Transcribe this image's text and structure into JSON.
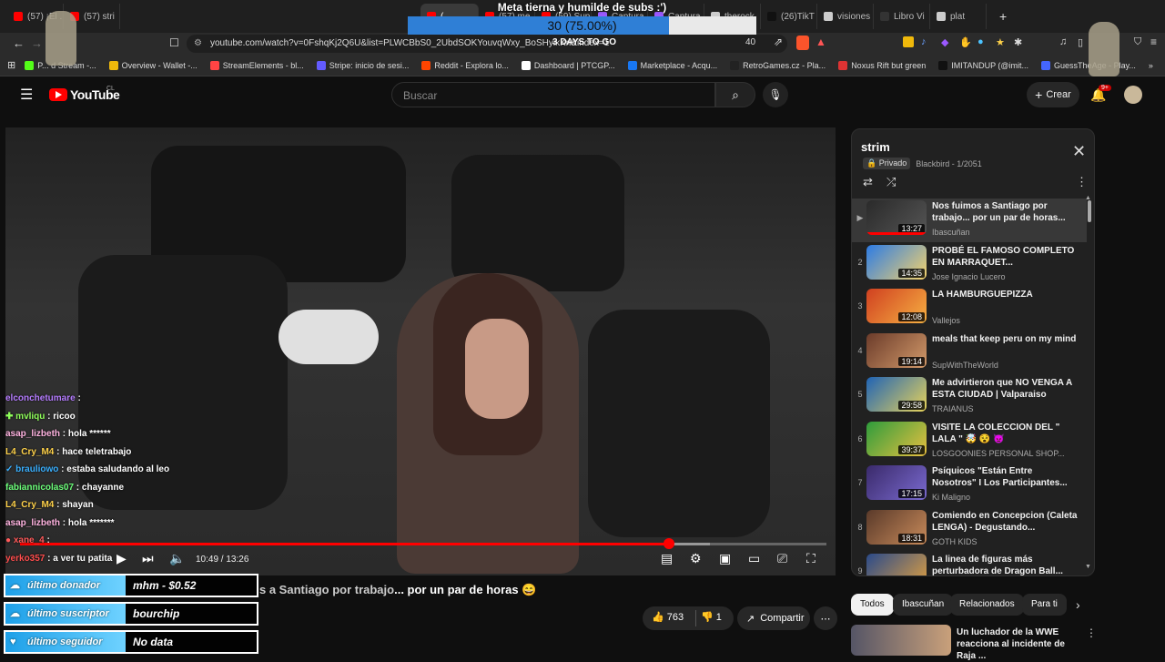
{
  "browser": {
    "tabs": [
      {
        "label": "(57) ¡El ...",
        "color": "#ff0000"
      },
      {
        "label": "(57) stri",
        "color": "#ff0000"
      },
      {
        "label": "(",
        "color": "#ff0000",
        "active": true
      },
      {
        "label": "(57) me",
        "color": "#ff0000"
      },
      {
        "label": "(59) Sup",
        "color": "#ff0000"
      },
      {
        "label": "Captura",
        "color": "#9b59ff"
      },
      {
        "label": "Captura",
        "color": "#9b59ff"
      },
      {
        "label": "therock",
        "color": "#cccccc"
      },
      {
        "label": "(26)TikT",
        "color": "#111111"
      },
      {
        "label": "visiones",
        "color": "#cccccc"
      },
      {
        "label": "Libro Vi",
        "color": "#333333"
      },
      {
        "label": "plat",
        "color": "#cccccc"
      }
    ],
    "url": "youtube.com/watch?v=0FshqKj2Q6U&list=PLWCBbS0_2UbdSOKYouvqWxy_BoSHyikKn&index=1",
    "zoom": "40",
    "bookmarks": [
      {
        "label": "P... d Stream -...",
        "color": "#53fc18"
      },
      {
        "label": "Overview - Wallet -...",
        "color": "#f0b90b"
      },
      {
        "label": "StreamElements - bl...",
        "color": "#ff4444"
      },
      {
        "label": "Stripe: inicio de sesi...",
        "color": "#635bff"
      },
      {
        "label": "Reddit - Explora lo...",
        "color": "#ff4500"
      },
      {
        "label": "Dashboard | PTCGP...",
        "color": "#ffffff"
      },
      {
        "label": "Marketplace - Acqu...",
        "color": "#1877f2"
      },
      {
        "label": "RetroGames.cz - Pla...",
        "color": "#222222"
      },
      {
        "label": "Noxus Rift but green",
        "color": "#dd3333"
      },
      {
        "label": "IMITANDUP (@imit...",
        "color": "#111111"
      },
      {
        "label": "GuessTheAge - Play...",
        "color": "#4466ff"
      }
    ]
  },
  "goal": {
    "title": "Meta tierna y humilde de subs :')",
    "progress_text": "30 (75.00%)",
    "progress": 0.75,
    "days": "3 DAYS TO GO"
  },
  "yt": {
    "logo": "YouTube",
    "country": "CL",
    "search_placeholder": "Buscar",
    "create": "Crear",
    "notif_count": "9+"
  },
  "player": {
    "time": "10:49 / 13:26",
    "progress": 0.805,
    "loaded": 0.855
  },
  "chat": [
    {
      "user": "elconchetumare",
      "text": " : ",
      "color": "#b57cff"
    },
    {
      "user": "mvliqu",
      "text": " : ricoo",
      "color": "#8fff5a",
      "prefix": "✚ "
    },
    {
      "user": "asap_lizbeth",
      "text": " : hola ******",
      "color": "#ffb3e0"
    },
    {
      "user": "L4_Cry_M4",
      "text": " : hace teletrabajo",
      "color": "#ffd24a"
    },
    {
      "user": "brauliowo",
      "text": " : estaba saludando al leo",
      "color": "#3ab0ff",
      "prefix": "✓ "
    },
    {
      "user": "fabiannicolas07",
      "text": " : chayanne",
      "color": "#6cff7a"
    },
    {
      "user": "L4_Cry_M4",
      "text": " : shayan",
      "color": "#ffd24a"
    },
    {
      "user": "asap_lizbeth",
      "text": " : hola *******",
      "color": "#ffb3e0"
    },
    {
      "user": "xane_4",
      "text": " : ",
      "color": "#ff5a5a",
      "prefix": "● "
    },
    {
      "user": "yerko357",
      "text": " : a ver tu patita",
      "color": "#ff4d4d"
    }
  ],
  "playlist": {
    "title": "strim",
    "privacy": "Privado",
    "meta": "Blackbird - 1/2051",
    "items": [
      {
        "index": "▶",
        "title": "Nos fuimos a Santiago por trabajo... por un par de horas...",
        "channel": "Ibascuñan",
        "duration": "13:27",
        "c1": "#2a2a2a",
        "c2": "#555555"
      },
      {
        "index": "2",
        "title": "PROBÉ EL FAMOSO COMPLETO EN MARRAQUET...",
        "channel": "Jose Ignacio Lucero",
        "duration": "14:35",
        "c1": "#2c7be5",
        "c2": "#f5d36b"
      },
      {
        "index": "3",
        "title": "LA HAMBURGUEPIZZA",
        "channel": "Vallejos",
        "duration": "12:08",
        "c1": "#d04020",
        "c2": "#f6b042"
      },
      {
        "index": "4",
        "title": "meals that keep peru on my mind",
        "channel": "SupWithTheWorld",
        "duration": "19:14",
        "c1": "#6b3b2a",
        "c2": "#d39a6a"
      },
      {
        "index": "5",
        "title": "Me advirtieron que NO VENGA A ESTA CIUDAD | Valparaiso",
        "channel": "TRAIANUS",
        "duration": "29:58",
        "c1": "#1f63b5",
        "c2": "#e8d35a"
      },
      {
        "index": "6",
        "title": "VISITE LA COLECCION DEL \" LALA \" 🤯 😵 👿",
        "channel": "LOSGOONIES PERSONAL SHOP...",
        "duration": "39:37",
        "c1": "#2e9c3c",
        "c2": "#e8c040"
      },
      {
        "index": "7",
        "title": "Psíquicos \"Están Entre Nosotros\" I Los Participantes...",
        "channel": "Ki Maligno",
        "duration": "17:15",
        "c1": "#3a2a6a",
        "c2": "#7a6ad0"
      },
      {
        "index": "8",
        "title": "Comiendo en Concepcion (Caleta LENGA) - Degustando...",
        "channel": "GOTH KIDS",
        "duration": "18:31",
        "c1": "#5a3a2a",
        "c2": "#c88a5a"
      },
      {
        "index": "9",
        "title": "La linea de figuras más perturbadora de Dragon Ball...",
        "channel": "",
        "duration": "13:13",
        "c1": "#2a4a8a",
        "c2": "#e0a040"
      }
    ]
  },
  "chips": [
    "Todos",
    "Ibascuñan",
    "Relacionados",
    "Para ti"
  ],
  "video": {
    "title_fragment": "... por un par de horas 😄",
    "title_overlay": "s a Santiago por trabajo",
    "likes": "763",
    "dislikes": "1",
    "share": "Compartir"
  },
  "alerts": [
    {
      "label": "último donador",
      "value": "mhm - $0.52"
    },
    {
      "label": "último suscriptor",
      "value": "bourchip"
    },
    {
      "label": "último seguidor",
      "value": "No data"
    }
  ],
  "next_video": {
    "title": "Un luchador de la WWE reacciona al incidente de Raja ..."
  }
}
